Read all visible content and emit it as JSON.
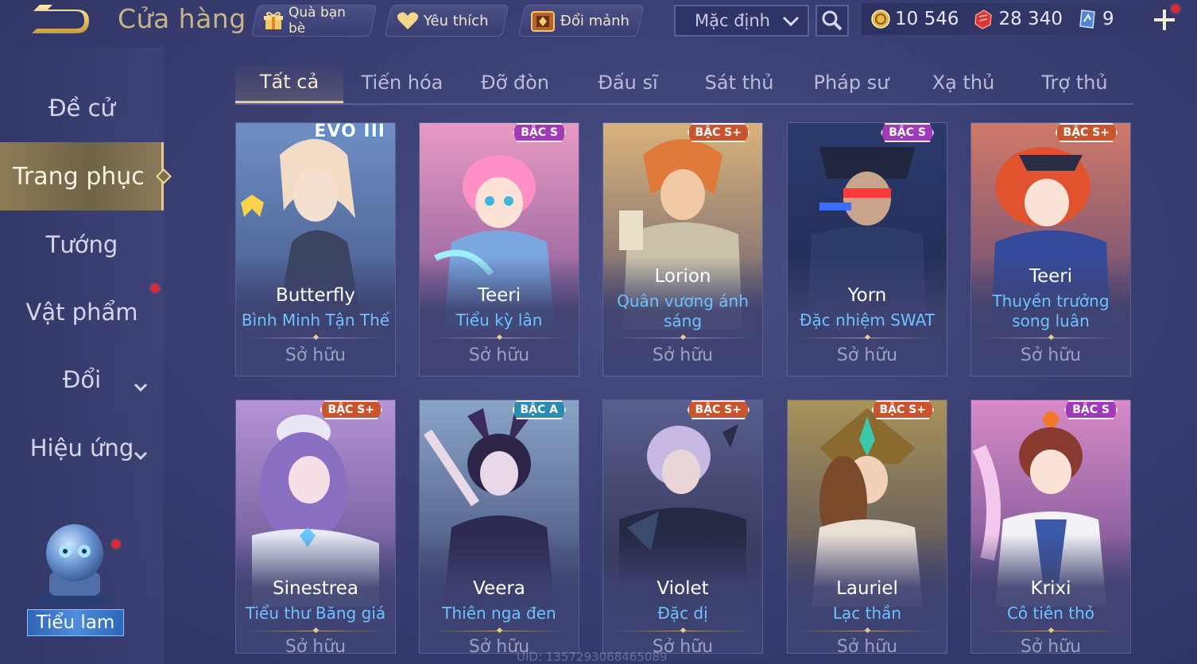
{
  "topbar": {
    "title": "Cửa hàng",
    "gift_label": "Quà bạn bè",
    "fav_label": "Yêu thích",
    "shard_label": "Đổi mảnh",
    "sort_value": "Mặc định",
    "gold": "10 546",
    "vouchers": "28 340",
    "tickets": "9"
  },
  "sidebar": {
    "items": [
      {
        "label": "Đề cử"
      },
      {
        "label": "Trang phục"
      },
      {
        "label": "Tướng"
      },
      {
        "label": "Vật phẩm"
      },
      {
        "label": "Đổi"
      },
      {
        "label": "Hiệu ứng"
      }
    ],
    "mascot_label": "Tiểu lam"
  },
  "tabs": [
    "Tất cả",
    "Tiến hóa",
    "Đỡ đòn",
    "Đấu sĩ",
    "Sát thủ",
    "Pháp sư",
    "Xạ thủ",
    "Trợ thủ"
  ],
  "cards": [
    {
      "hero": "Butterfly",
      "skin_line1": "Bình Minh Tận Thế",
      "skin_line2": "",
      "tier": "EVO III",
      "status": "Sở hữu"
    },
    {
      "hero": "Teeri",
      "skin_line1": "Tiểu kỳ lân",
      "skin_line2": "",
      "tier": "BẬC S",
      "status": "Sở hữu"
    },
    {
      "hero": "Lorion",
      "skin_line1": "Quân vương ánh",
      "skin_line2": "sáng",
      "tier": "BẬC S+",
      "status": "Sở hữu"
    },
    {
      "hero": "Yorn",
      "skin_line1": "Đặc nhiệm SWAT",
      "skin_line2": "",
      "tier": "BẬC S",
      "status": "Sở hữu"
    },
    {
      "hero": "Teeri",
      "skin_line1": "Thuyền trưởng",
      "skin_line2": "song luân",
      "tier": "BẬC S+",
      "status": "Sở hữu"
    },
    {
      "hero": "Sinestrea",
      "skin_line1": "Tiểu thư Băng giá",
      "skin_line2": "",
      "tier": "BẬC S+",
      "status": "Sở hữu"
    },
    {
      "hero": "Veera",
      "skin_line1": "Thiên nga đen",
      "skin_line2": "",
      "tier": "BẬC A",
      "status": "Sở hữu"
    },
    {
      "hero": "Violet",
      "skin_line1": "Đặc dị",
      "skin_line2": "",
      "tier": "BẬC S+",
      "status": "Sở hữu"
    },
    {
      "hero": "Lauriel",
      "skin_line1": "Lạc thần",
      "skin_line2": "",
      "tier": "BẬC S+",
      "status": "Sở hữu"
    },
    {
      "hero": "Krixi",
      "skin_line1": "Cô tiên thỏ",
      "skin_line2": "",
      "tier": "BẬC S",
      "status": "Sở hữu"
    }
  ],
  "uid_text": "UID: 1357293068465089",
  "colors": {
    "accent_gold": "#e5cf95",
    "skin_name_blue": "#6ec2ff",
    "notify_red": "#e3262b"
  }
}
